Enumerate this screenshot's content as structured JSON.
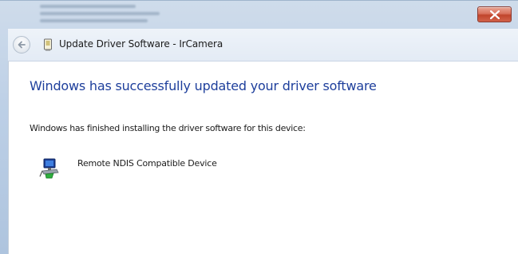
{
  "window": {
    "title": "Update Driver Software - IrCamera",
    "close_glyph": "x",
    "close_color": "#c94a30"
  },
  "content": {
    "heading": "Windows has successfully updated your driver software",
    "message": "Windows has finished installing the driver software for this device:",
    "device_name": "Remote NDIS Compatible Device"
  },
  "icons": {
    "back": "back-arrow-icon",
    "app": "device-manager-icon",
    "device": "network-adapter-icon",
    "close": "close-icon"
  },
  "colors": {
    "heading": "#1e3f9c",
    "frame": "#bccfe6"
  }
}
